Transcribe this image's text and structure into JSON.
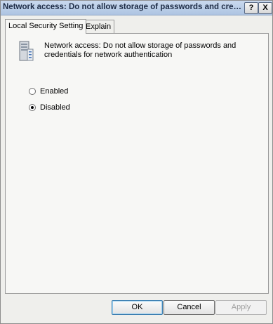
{
  "window": {
    "title": "Network access: Do not allow storage of passwords and credentia...",
    "help_button": "?",
    "close_button": "X"
  },
  "tabs": [
    {
      "label": "Local Security Setting",
      "active": true
    },
    {
      "label": "Explain",
      "active": false
    }
  ],
  "policy": {
    "icon": "server-policy-icon",
    "description": "Network access: Do not allow storage of passwords and credentials for network authentication"
  },
  "options": [
    {
      "label": "Enabled",
      "selected": false
    },
    {
      "label": "Disabled",
      "selected": true
    }
  ],
  "buttons": {
    "ok": "OK",
    "cancel": "Cancel",
    "apply": "Apply"
  }
}
